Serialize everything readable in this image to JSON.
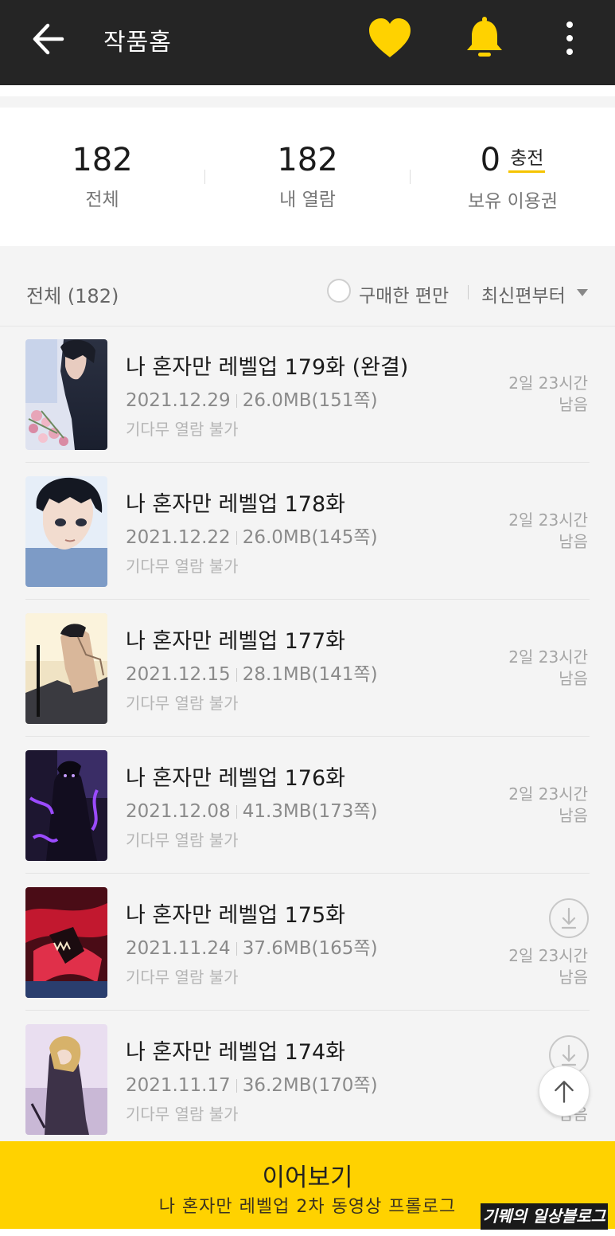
{
  "header": {
    "title": "작품홈",
    "colors": {
      "bar": "#252525",
      "accent": "#ffd200"
    }
  },
  "stats": [
    {
      "value": "182",
      "label": "전체"
    },
    {
      "value": "182",
      "label": "내 열람"
    },
    {
      "value": "0",
      "label": "보유 이용권",
      "action": "충전"
    }
  ],
  "list_header": {
    "all_label": "전체 (182)",
    "purchased_only": "구매한 편만",
    "purchased_only_checked": false,
    "sort": "최신편부터"
  },
  "episodes": [
    {
      "title": "나 혼자만 레벨업 179화 (완결)",
      "date": "2021.12.29",
      "size": "26.0MB(151쪽)",
      "note": "기다무 열람 불가",
      "remain1": "2일 23시간",
      "remain2": "남음",
      "download": false
    },
    {
      "title": "나 혼자만 레벨업 178화",
      "date": "2021.12.22",
      "size": "26.0MB(145쪽)",
      "note": "기다무 열람 불가",
      "remain1": "2일 23시간",
      "remain2": "남음",
      "download": false
    },
    {
      "title": "나 혼자만 레벨업 177화",
      "date": "2021.12.15",
      "size": "28.1MB(141쪽)",
      "note": "기다무 열람 불가",
      "remain1": "2일 23시간",
      "remain2": "남음",
      "download": false
    },
    {
      "title": "나 혼자만 레벨업 176화",
      "date": "2021.12.08",
      "size": "41.3MB(173쪽)",
      "note": "기다무 열람 불가",
      "remain1": "2일 23시간",
      "remain2": "남음",
      "download": false
    },
    {
      "title": "나 혼자만 레벨업 175화",
      "date": "2021.11.24",
      "size": "37.6MB(165쪽)",
      "note": "기다무 열람 불가",
      "remain1": "2일 23시간",
      "remain2": "남음",
      "download": true
    },
    {
      "title": "나 혼자만 레벨업 174화",
      "date": "2021.11.17",
      "size": "36.2MB(170쪽)",
      "note": "기다무 열람 불가",
      "remain1": "2일 2",
      "remain2": "남음",
      "download": true
    }
  ],
  "continue_button": {
    "label": "이어보기",
    "subtitle": "나 혼자만 레벨업 2차 동영상 프롤로그"
  },
  "watermark": "기뭬의 일상블로그"
}
